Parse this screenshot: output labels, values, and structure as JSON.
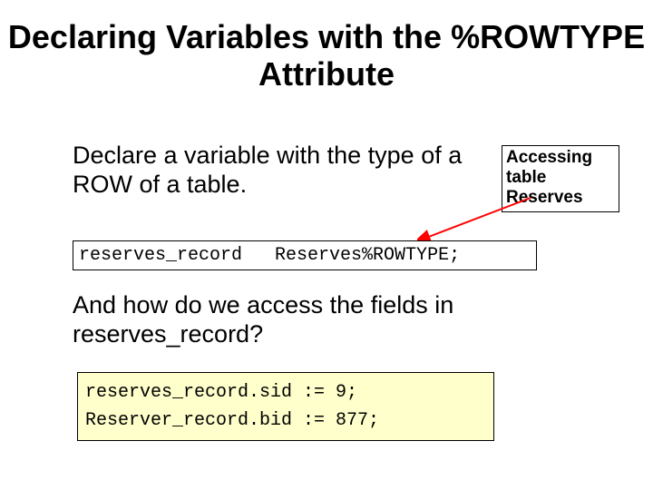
{
  "title": "Declaring Variables with the %ROWTYPE Attribute",
  "intro": "Declare a variable with the type of a ROW of a table.",
  "callout_line1": "Accessing",
  "callout_line2": "table",
  "callout_line3": " Reserves",
  "code1": "reserves_record   Reserves%ROWTYPE;",
  "question": "And how do we access the fields in reserves_record?",
  "code2_line1": "reserves_record.sid := 9;",
  "code2_line2": "Reserver_record.bid := 877;"
}
